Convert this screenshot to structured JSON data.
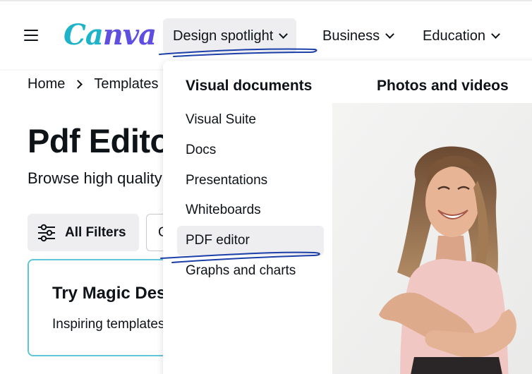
{
  "header": {
    "logo_text": "Canva",
    "nav": [
      {
        "label": "Design spotlight",
        "active": true
      },
      {
        "label": "Business",
        "active": false
      },
      {
        "label": "Education",
        "active": false
      }
    ]
  },
  "breadcrumb": {
    "home": "Home",
    "current": "Templates"
  },
  "page": {
    "title": "Pdf Editor",
    "subtitle": "Browse high quality",
    "filters_label": "All Filters",
    "second_filter_label": "C",
    "magic_card": {
      "title": "Try Magic Design",
      "subtitle": "Inspiring templates"
    }
  },
  "dropdown": {
    "visual_documents": {
      "heading": "Visual documents",
      "items": [
        "Visual Suite",
        "Docs",
        "Presentations",
        "Whiteboards",
        "PDF editor",
        "Graphs and charts"
      ],
      "hovered_index": 4
    },
    "photos_and_videos": {
      "heading": "Photos and videos"
    }
  },
  "colors": {
    "brand_teal": "#1fb3c9",
    "brand_purple": "#5f4fe0",
    "annotation": "#1d3fa8",
    "hover_bg": "#eeeef1",
    "card_border": "#5fc6d6"
  },
  "icons": [
    "hamburger-icon",
    "chevron-down-icon",
    "chevron-right-icon",
    "sliders-icon"
  ]
}
